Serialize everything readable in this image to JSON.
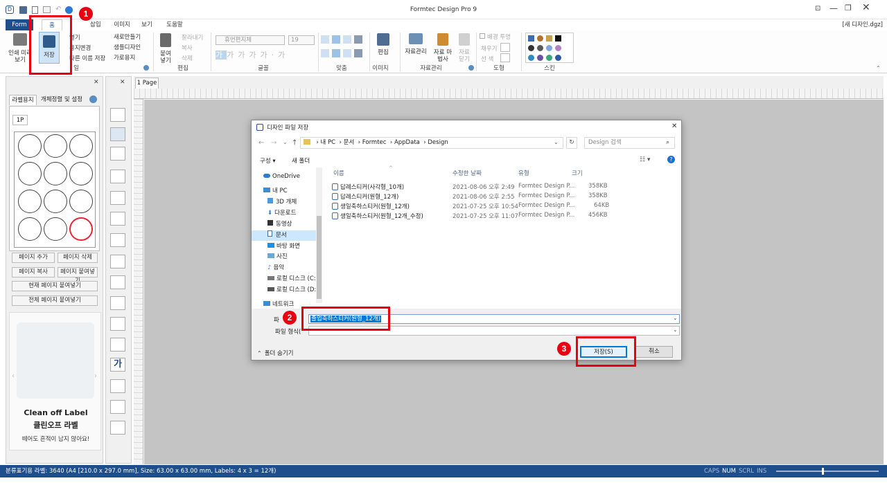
{
  "app": {
    "title": "Formtec Design Pro 9",
    "doc_title": "[새 디자인.dgz]"
  },
  "tabs": [
    "Form",
    "홈",
    "",
    "삽입",
    "이미지",
    "보기",
    "도움말"
  ],
  "ribbon": {
    "print_label": "인쇄 미리보기",
    "save_label": "저장",
    "file_items": [
      "열기",
      "용지변경",
      "다른 이름 저장"
    ],
    "new_items": [
      "새로만들기",
      "샘플디자인",
      "가로용지"
    ],
    "file_group": "일",
    "paste_label": "붙여 넣기",
    "edit_items": [
      "잘라내기",
      "복사",
      "삭제"
    ],
    "edit_group": "편집",
    "font_name": "휴먼편지체",
    "font_size": "19",
    "font_group": "글꼴",
    "align_group": "맞춤",
    "edit_img_label": "편집",
    "image_group": "이미지",
    "dm_label": "자료관리",
    "dw_label": "자료 마법사",
    "dc_label": "자료 닫기",
    "data_group": "자료관리",
    "shape_items": [
      "배경 투명",
      "채우기",
      "선   색"
    ],
    "shape_group": "도형",
    "skin_group": "스킨"
  },
  "left_panel": {
    "tabs": [
      "라벨용지",
      "개체정렬 및 설정"
    ],
    "page_tab": "1P",
    "buttons": [
      "페이지 추가",
      "페이지 삭제",
      "페이지 복사",
      "페이지 붙여넣기",
      "현재 페이지 붙여넣기",
      "전체 페이지 붙여넣기"
    ],
    "ad_title": "Clean off Label",
    "ad_sub": "클린오프 라벨",
    "ad_desc": "떼어도 흔적이 남지 않아요!"
  },
  "canvas": {
    "tab": "1 Page"
  },
  "dialog": {
    "title": "디자인 파일 저장",
    "path": [
      "내 PC",
      "문서",
      "Formtec",
      "AppData",
      "Design"
    ],
    "search_placeholder": "Design 검색",
    "organize": "구성 ▾",
    "new_folder": "새 폴더",
    "nav": [
      "OneDrive",
      "내 PC",
      "3D 개체",
      "다운로드",
      "동영상",
      "문서",
      "바탕 화면",
      "사진",
      "음악",
      "로컬 디스크 (C:)",
      "로컬 디스크 (D:)",
      "네트워크"
    ],
    "columns": [
      "이름",
      "수정한 날짜",
      "유형",
      "크기"
    ],
    "files": [
      {
        "name": "답례스티커(사각형_10개)",
        "date": "2021-08-06 오후 2:49",
        "type": "Formtec Design P...",
        "size": "358KB"
      },
      {
        "name": "답례스티커(원형_12개)",
        "date": "2021-08-06 오후 2:55",
        "type": "Formtec Design P...",
        "size": "358KB"
      },
      {
        "name": "생일축하스티커(원형_12개)",
        "date": "2021-07-25 오후 10:54",
        "type": "Formtec Design P...",
        "size": "64KB"
      },
      {
        "name": "생일축하스티커(원형_12개_수정)",
        "date": "2021-07-25 오후 11:07",
        "type": "Formtec Design P...",
        "size": "456KB"
      }
    ],
    "filename_label": "파",
    "filename_value": "졸업축하스티커(원형_12개)",
    "filetype_label": "파일 형식(",
    "hide_folders": "폴더 숨기기",
    "save_btn": "저장(S)",
    "cancel_btn": "취소"
  },
  "badges": [
    "1",
    "2",
    "3"
  ],
  "status": {
    "left": "분류표기용 라벨: 3640 (A4 [210.0 x 297.0 mm], Size: 63.00 x 63.00 mm,  Labels: 4 x 3 = 12개)",
    "keys": [
      "CAPS",
      "NUM",
      "SCRL",
      "INS"
    ]
  },
  "colors": {
    "accent": "#1f4e8c",
    "highlight": "#e60012",
    "select": "#cce8ff"
  }
}
